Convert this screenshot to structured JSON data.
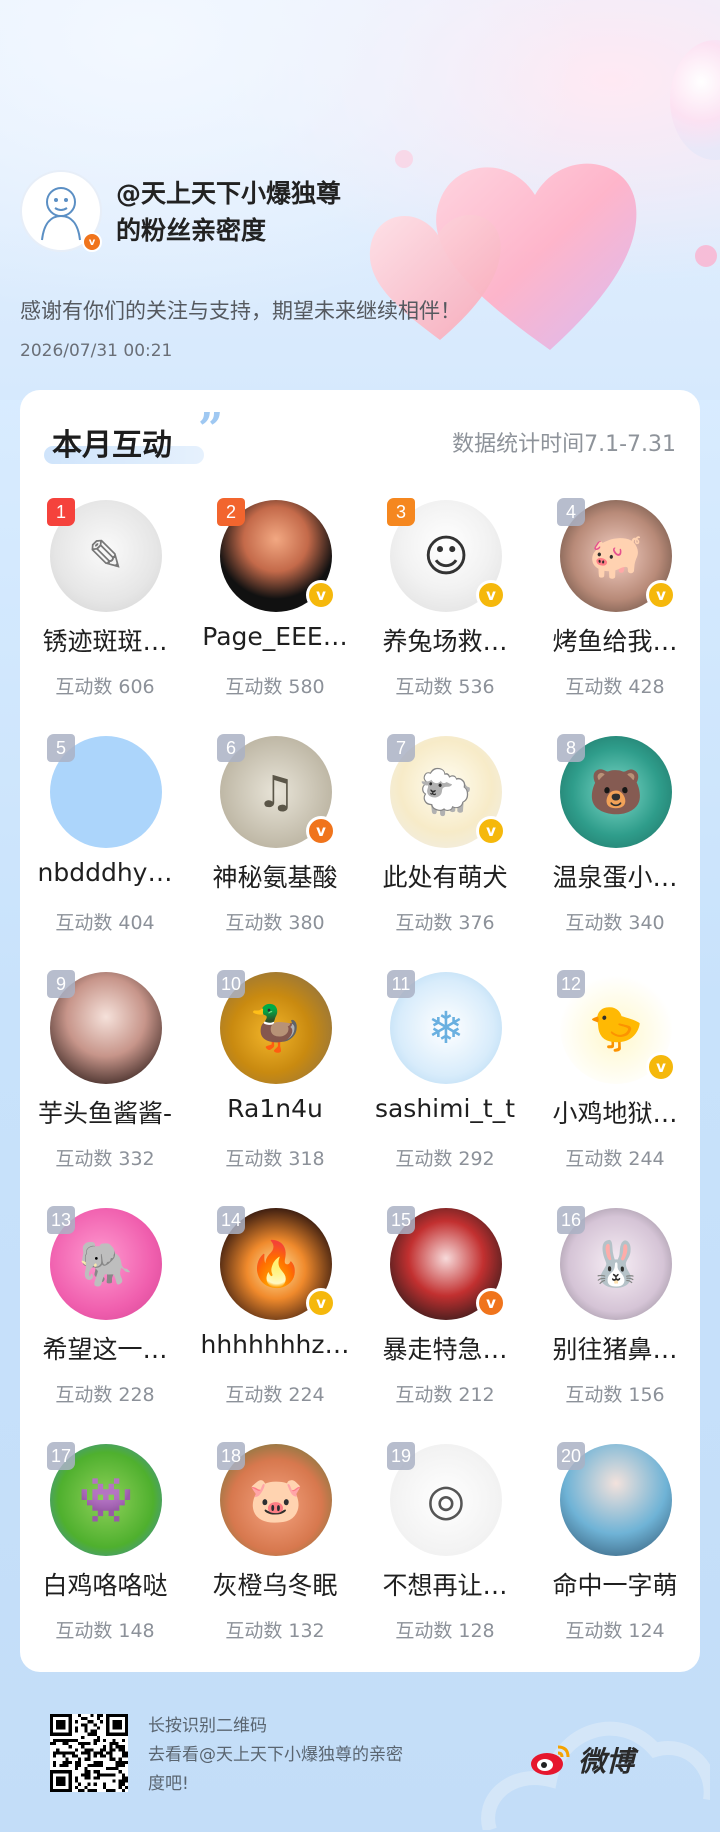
{
  "header": {
    "title_line1": "@天上天下小爆独尊",
    "title_line2": "的粉丝亲密度",
    "thanks": "感谢有你们的关注与支持，期望未来继续相伴！",
    "datetime": "2026/07/31  00:21"
  },
  "card": {
    "section_title": "本月互动",
    "quote": "”",
    "stat_period": "数据统计时间7.1-7.31"
  },
  "fans": [
    {
      "rank": "1",
      "name": "锈迹斑斑…",
      "count": "互动数 606",
      "badge": "",
      "avatar": "sketch-girl"
    },
    {
      "rank": "2",
      "name": "Page_EEE…",
      "count": "互动数 580",
      "badge": "gold",
      "avatar": "idol-photo"
    },
    {
      "rank": "3",
      "name": "养兔场救…",
      "count": "互动数 536",
      "badge": "gold",
      "avatar": "anime-boy"
    },
    {
      "rank": "4",
      "name": "烤鱼给我…",
      "count": "互动数 428",
      "badge": "gold",
      "avatar": "piglet"
    },
    {
      "rank": "5",
      "name": "nbdddhy…",
      "count": "互动数 404",
      "badge": "",
      "avatar": "blank-blue"
    },
    {
      "rank": "6",
      "name": "神秘氨基酸",
      "count": "互动数 380",
      "badge": "orange",
      "avatar": "piano-sketch"
    },
    {
      "rank": "7",
      "name": "此处有萌犬",
      "count": "互动数 376",
      "badge": "gold",
      "avatar": "sheep"
    },
    {
      "rank": "8",
      "name": "温泉蛋小…",
      "count": "互动数 340",
      "badge": "",
      "avatar": "bear-water"
    },
    {
      "rank": "9",
      "name": "芋头鱼酱酱-",
      "count": "互动数 332",
      "badge": "",
      "avatar": "girl-photo"
    },
    {
      "rank": "10",
      "name": "Ra1n4u",
      "count": "互动数 318",
      "badge": "",
      "avatar": "duck-toy"
    },
    {
      "rank": "11",
      "name": "sashimi_t_t",
      "count": "互动数 292",
      "badge": "",
      "avatar": "white-bear"
    },
    {
      "rank": "12",
      "name": "小鸡地狱…",
      "count": "互动数 244",
      "badge": "gold",
      "avatar": "chick"
    },
    {
      "rank": "13",
      "name": "希望这一…",
      "count": "互动数 228",
      "badge": "",
      "avatar": "pink-elephant"
    },
    {
      "rank": "14",
      "name": "hhhhhhhz…",
      "count": "互动数 224",
      "badge": "gold",
      "avatar": "fire"
    },
    {
      "rank": "15",
      "name": "暴走特急…",
      "count": "互动数 212",
      "badge": "orange",
      "avatar": "red-hair"
    },
    {
      "rank": "16",
      "name": "别往猪鼻…",
      "count": "互动数 156",
      "badge": "",
      "avatar": "bunny-hood"
    },
    {
      "rank": "17",
      "name": "白鸡咯咯哒",
      "count": "互动数 148",
      "badge": "",
      "avatar": "pixel-monster"
    },
    {
      "rank": "18",
      "name": "灰橙乌冬眠",
      "count": "互动数 132",
      "badge": "",
      "avatar": "pig-cartoon"
    },
    {
      "rank": "19",
      "name": "不想再让…",
      "count": "互动数 128",
      "badge": "",
      "avatar": "sketch-face"
    },
    {
      "rank": "20",
      "name": "命中一字萌",
      "count": "互动数 124",
      "badge": "",
      "avatar": "girl-blue-coat"
    }
  ],
  "footer": {
    "line1": "长按识别二维码",
    "line2": "去看看@天上天下小爆独尊的亲密",
    "line3": "度吧!",
    "brand": "微博"
  },
  "colors": {
    "rank1": "#f5423c",
    "rank2": "#f2652e",
    "rank3": "#f5871f",
    "badge_gold": "#f5b80c",
    "badge_orange": "#f0741c"
  }
}
